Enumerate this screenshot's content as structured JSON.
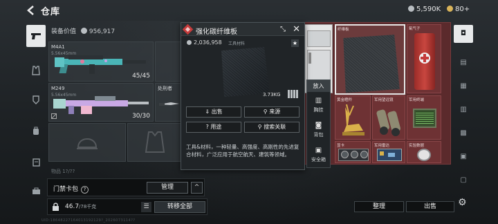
{
  "header": {
    "title": "仓库",
    "currency_silver": "5,590K",
    "currency_gold": "80+",
    "silver_color": "#b9bec2",
    "gold_color": "#d9b45a"
  },
  "equipment": {
    "value_label": "装备价值",
    "value": "956,917",
    "slots": [
      {
        "name": "M4A1",
        "sub": "5.56x45mm",
        "count": "45/45"
      },
      {
        "name": "M249",
        "sub": "5.56x45mm",
        "count": "30/30"
      },
      {
        "name": "处刑者",
        "sub": "",
        "count": ""
      }
    ],
    "partial_label": "物品  1?/??"
  },
  "card_bar": {
    "label": "门禁卡包",
    "manage": "管理",
    "chevron": "^"
  },
  "capacity": {
    "value": "46.7",
    "unit": "/78千克",
    "transfer_all": "转移全部"
  },
  "uid_text": "UID:18648227164013192129?_2026073114??",
  "popup": {
    "title": "强化碳纤维板",
    "price": "2,036,958",
    "category": "工具材料",
    "weight": "3.73KG",
    "buttons": [
      "出售",
      "来源",
      "用途",
      "搜索关联"
    ],
    "description": "工具&材料，一种轻量、高强度、高刚性的先进复合材料，广泛应用于航空航天、建筑等领域。"
  },
  "actions": {
    "put_in": "放入",
    "items": [
      "胸挂",
      "背包",
      "安全箱"
    ]
  },
  "container": {
    "cells": [
      {
        "label": "纤维板"
      },
      {
        "label": "氧气子"
      },
      {
        "label": "黄金瞪羚"
      },
      {
        "label": "军用望远镜"
      },
      {
        "label": "军用终端"
      },
      {
        "label": "显卡"
      },
      {
        "label": "军用雷达"
      },
      {
        "label": "实验数据"
      }
    ]
  },
  "bottom": {
    "tidy": "整理",
    "sell": "出售"
  }
}
